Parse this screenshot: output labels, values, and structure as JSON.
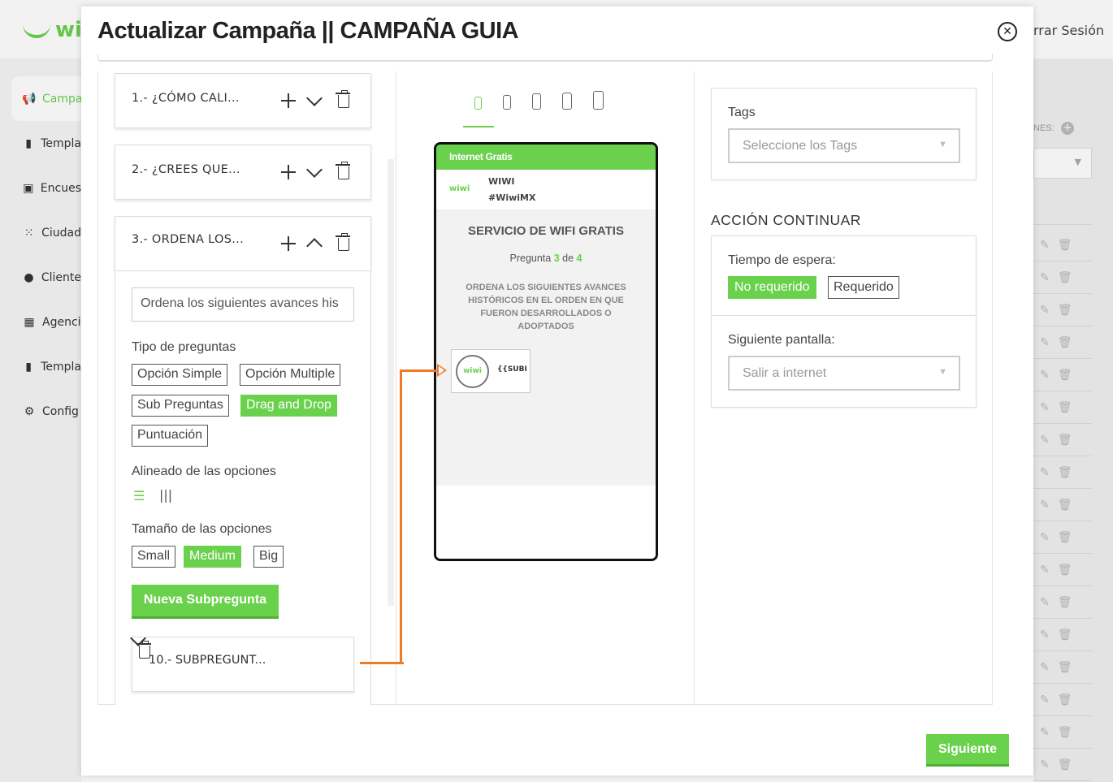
{
  "background": {
    "logo_text": "wi",
    "logout_label": "rrar Sesión",
    "menu": [
      {
        "label": "Campa",
        "icon": "megaphone-icon",
        "active": true
      },
      {
        "label": "Templa",
        "icon": "layout-icon",
        "active": false
      },
      {
        "label": "Encues",
        "icon": "clipboard-icon",
        "active": false
      },
      {
        "label": "Ciudad",
        "icon": "grid-dots-icon",
        "active": false
      },
      {
        "label": "Cliente",
        "icon": "users-icon",
        "active": false
      },
      {
        "label": "Agenci",
        "icon": "building-icon",
        "active": false
      },
      {
        "label": "Templa",
        "icon": "layout-icon",
        "active": false
      },
      {
        "label": "Config",
        "icon": "gear-icon",
        "active": false
      }
    ],
    "right_label": "NES:",
    "table_rows": 17
  },
  "modal": {
    "title": "Actualizar Campaña || CAMPAÑA GUIA",
    "questions": [
      {
        "label": "1.- ¿CÓMO CALI..."
      },
      {
        "label": "2.- ¿CREES QUE..."
      },
      {
        "label": "3.- ORDENA LOS..."
      }
    ],
    "editor": {
      "question_text": "Ordena los siguientes avances his",
      "type_label": "Tipo de preguntas",
      "types": [
        "Opción Simple",
        "Opción Multiple",
        "Sub Preguntas",
        "Drag and Drop",
        "Puntuación"
      ],
      "selected_type": "Drag and Drop",
      "align_label": "Alineado de las opciones",
      "size_label": "Tamaño de las opciones",
      "sizes": [
        "Small",
        "Medium",
        "Big"
      ],
      "selected_size": "Medium",
      "new_sub_label": "Nueva Subpregunta",
      "sub_label": "10.- SUBPREGUNT..."
    },
    "preview": {
      "top_bar": "Internet Gratis",
      "brand_logo": "wiwi",
      "brand_name": "WIWI",
      "hashtag": "#WiwiMX",
      "title": "SERVICIO DE WIFI GRATIS",
      "progress_prefix": "Pregunta",
      "progress_current": "3",
      "progress_sep": "de",
      "progress_total": "4",
      "question": "ORDENA LOS SIGUIENTES AVANCES HISTÓRICOS EN EL ORDEN EN QUE FUERON DESARROLLADOS O ADOPTADOS",
      "item_logo": "wiwi",
      "item_text": "{{SUBPREGUNTA}}"
    },
    "settings": {
      "tags_label": "Tags",
      "tags_placeholder": "Seleccione los Tags",
      "section_title": "ACCIÓN CONTINUAR",
      "wait_label": "Tiempo de espera:",
      "wait_options": [
        "No requerido",
        "Requerido"
      ],
      "wait_selected": "No requerido",
      "next_label": "Siguiente pantalla:",
      "next_value": "Salir a internet"
    },
    "next_button": "Siguiente"
  },
  "colors": {
    "accent": "#6ad14d",
    "arrow": "#f07a26"
  }
}
